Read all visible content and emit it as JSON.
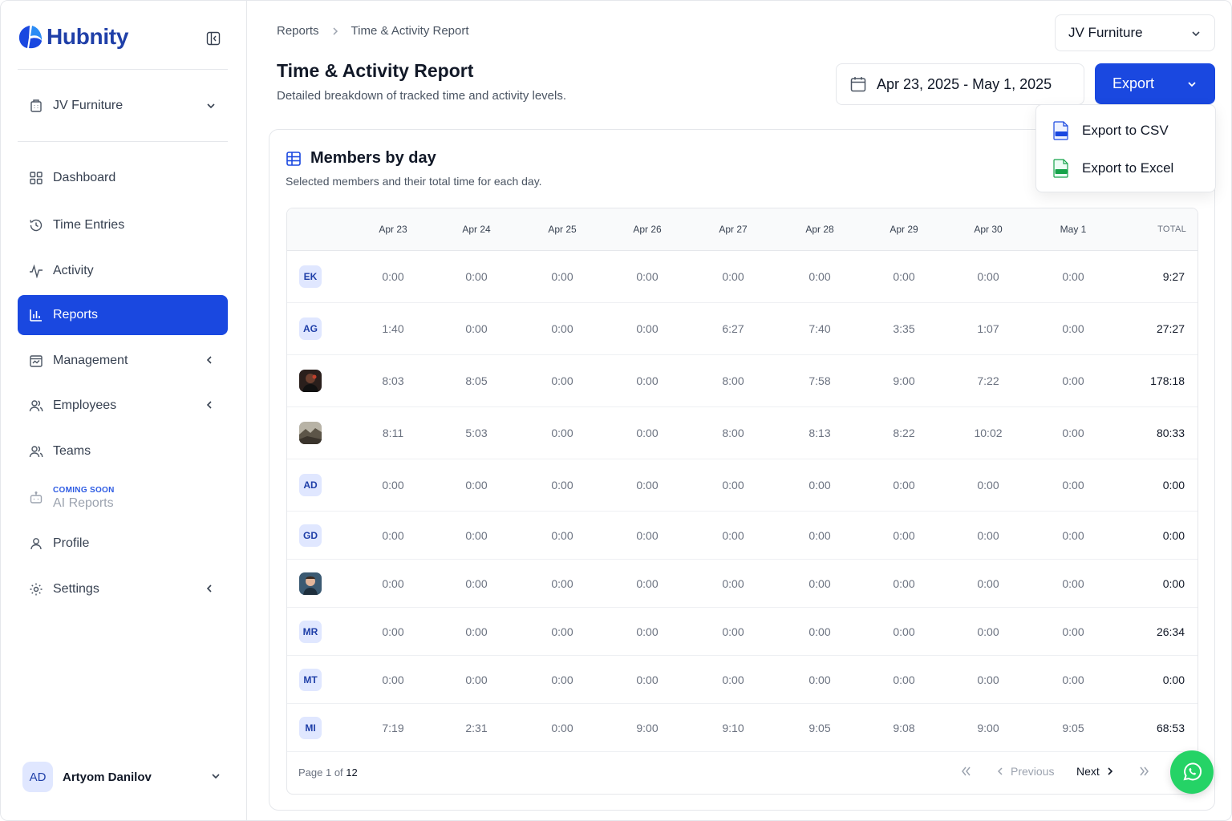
{
  "brand": {
    "name": "Hubnity"
  },
  "sidebar": {
    "org_label": "JV Furniture",
    "items": [
      {
        "label": "Dashboard",
        "icon": "grid-icon"
      },
      {
        "label": "Time Entries",
        "icon": "history-icon"
      },
      {
        "label": "Activity",
        "icon": "activity-icon"
      },
      {
        "label": "Reports",
        "icon": "bar-chart-icon",
        "active": true
      },
      {
        "label": "Management",
        "icon": "calendar-chart-icon"
      },
      {
        "label": "Employees",
        "icon": "users-icon"
      },
      {
        "label": "Teams",
        "icon": "users-icon"
      },
      {
        "label": "AI Reports",
        "tag": "COMING SOON",
        "icon": "bot-icon"
      },
      {
        "label": "Profile",
        "icon": "user-icon"
      },
      {
        "label": "Settings",
        "icon": "gear-icon"
      }
    ],
    "user": {
      "initials": "AD",
      "name": "Artyom Danilov"
    }
  },
  "header": {
    "breadcrumb": [
      "Reports",
      "Time & Activity Report"
    ],
    "title": "Time & Activity Report",
    "subtitle": "Detailed breakdown of tracked time and activity levels.",
    "org_dropdown": "JV Furniture",
    "date_range": "Apr 23, 2025 - May 1, 2025",
    "export_label": "Export",
    "export_menu": [
      "Export to CSV",
      "Export to Excel"
    ]
  },
  "card": {
    "title": "Members by day",
    "subtitle": "Selected members and their total time for each day.",
    "columns": [
      "Apr 23",
      "Apr 24",
      "Apr 25",
      "Apr 26",
      "Apr 27",
      "Apr 28",
      "Apr 29",
      "Apr 30",
      "May 1"
    ],
    "total_label": "TOTAL",
    "rows": [
      {
        "initials": "EK",
        "values": [
          "0:00",
          "0:00",
          "0:00",
          "0:00",
          "0:00",
          "0:00",
          "0:00",
          "0:00",
          "0:00"
        ],
        "total": "9:27"
      },
      {
        "initials": "AG",
        "values": [
          "1:40",
          "0:00",
          "0:00",
          "0:00",
          "6:27",
          "7:40",
          "3:35",
          "1:07",
          "0:00"
        ],
        "total": "27:27"
      },
      {
        "initials": "",
        "photo": "dark",
        "values": [
          "8:03",
          "8:05",
          "0:00",
          "0:00",
          "8:00",
          "7:58",
          "9:00",
          "7:22",
          "0:00"
        ],
        "total": "178:18"
      },
      {
        "initials": "",
        "photo": "landscape",
        "values": [
          "8:11",
          "5:03",
          "0:00",
          "0:00",
          "8:00",
          "8:13",
          "8:22",
          "10:02",
          "0:00"
        ],
        "total": "80:33"
      },
      {
        "initials": "AD",
        "values": [
          "0:00",
          "0:00",
          "0:00",
          "0:00",
          "0:00",
          "0:00",
          "0:00",
          "0:00",
          "0:00"
        ],
        "total": "0:00"
      },
      {
        "initials": "GD",
        "values": [
          "0:00",
          "0:00",
          "0:00",
          "0:00",
          "0:00",
          "0:00",
          "0:00",
          "0:00",
          "0:00"
        ],
        "total": "0:00"
      },
      {
        "initials": "",
        "photo": "face",
        "values": [
          "0:00",
          "0:00",
          "0:00",
          "0:00",
          "0:00",
          "0:00",
          "0:00",
          "0:00",
          "0:00"
        ],
        "total": "0:00"
      },
      {
        "initials": "MR",
        "values": [
          "0:00",
          "0:00",
          "0:00",
          "0:00",
          "0:00",
          "0:00",
          "0:00",
          "0:00",
          "0:00"
        ],
        "total": "26:34"
      },
      {
        "initials": "MT",
        "values": [
          "0:00",
          "0:00",
          "0:00",
          "0:00",
          "0:00",
          "0:00",
          "0:00",
          "0:00",
          "0:00"
        ],
        "total": "0:00"
      },
      {
        "initials": "MI",
        "values": [
          "7:19",
          "2:31",
          "0:00",
          "9:00",
          "9:10",
          "9:05",
          "9:08",
          "9:00",
          "9:05"
        ],
        "total": "68:53"
      }
    ],
    "pagination": {
      "prefix": "Page 1 of",
      "total_pages": "12",
      "previous": "Previous",
      "next": "Next"
    }
  },
  "colors": {
    "accent": "#1a48e0",
    "whatsapp": "#25d366"
  }
}
